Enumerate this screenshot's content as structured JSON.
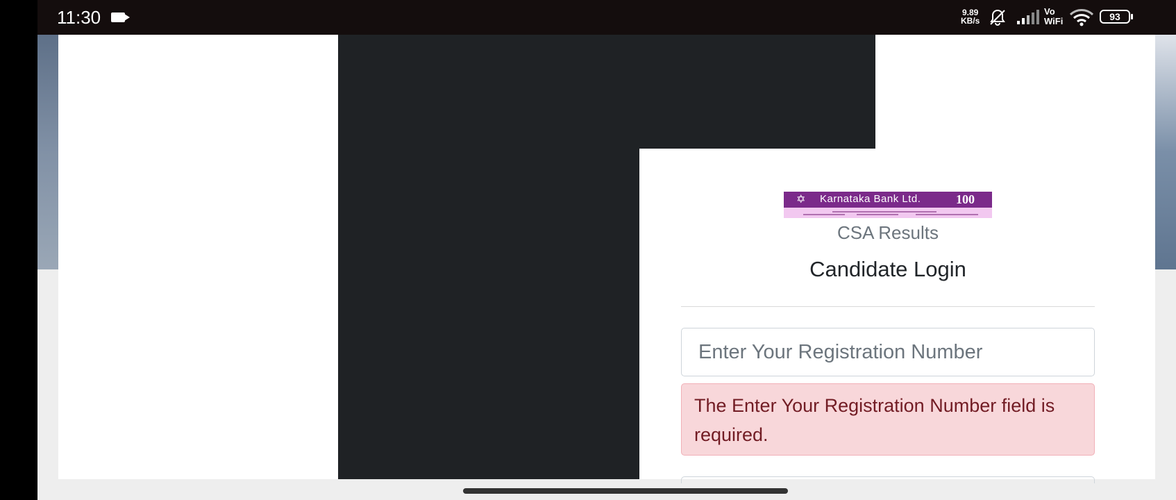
{
  "status_bar": {
    "time": "11:30",
    "camera_icon": "video-camera-icon",
    "net_speed_value": "9.89",
    "net_speed_unit": "KB/s",
    "mute_icon": "mute-bell-icon",
    "signal_icon": "cell-signal-icon",
    "vowifi_top": "Vo",
    "vowifi_bottom": "WiFi",
    "wifi_icon": "wifi-icon",
    "battery_level": "93",
    "indicator_color": "#19d45a"
  },
  "card": {
    "logo": {
      "bank_name": "Karnataka Bank Ltd.",
      "anniversary": "100",
      "brand_color": "#7b2a8a"
    },
    "subtitle": "CSA Results",
    "title": "Candidate Login",
    "registration_input": {
      "placeholder": "Enter Your Registration Number",
      "value": ""
    },
    "error_message": "The Enter Your Registration Number field is required.",
    "error_colors": {
      "background": "#f8d7da",
      "text": "#721c24"
    }
  }
}
